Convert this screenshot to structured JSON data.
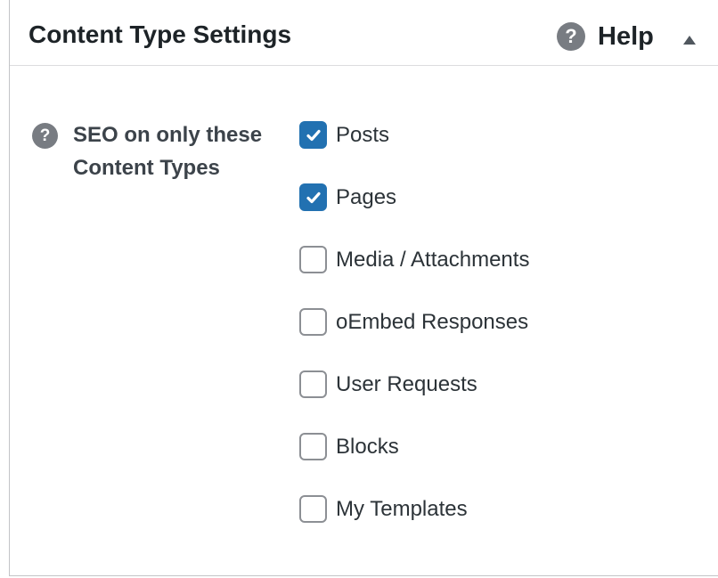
{
  "panel": {
    "title": "Content Type Settings",
    "help": {
      "icon": "question-circle-icon",
      "icon_glyph": "?",
      "label": "Help"
    },
    "toggle_icon": "collapse-up-arrow-icon"
  },
  "seo_setting": {
    "help_icon": "question-circle-icon",
    "help_glyph": "?",
    "label": "SEO on only these Content Types",
    "options": [
      {
        "label": "Posts",
        "checked": true
      },
      {
        "label": "Pages",
        "checked": true
      },
      {
        "label": "Media / Attachments",
        "checked": false
      },
      {
        "label": "oEmbed Responses",
        "checked": false
      },
      {
        "label": "User Requests",
        "checked": false
      },
      {
        "label": "Blocks",
        "checked": false
      },
      {
        "label": "My Templates",
        "checked": false
      }
    ]
  },
  "colors": {
    "checked_blue": "#2271b1",
    "help_gray": "#787c82",
    "text_dark": "#1d2327"
  }
}
